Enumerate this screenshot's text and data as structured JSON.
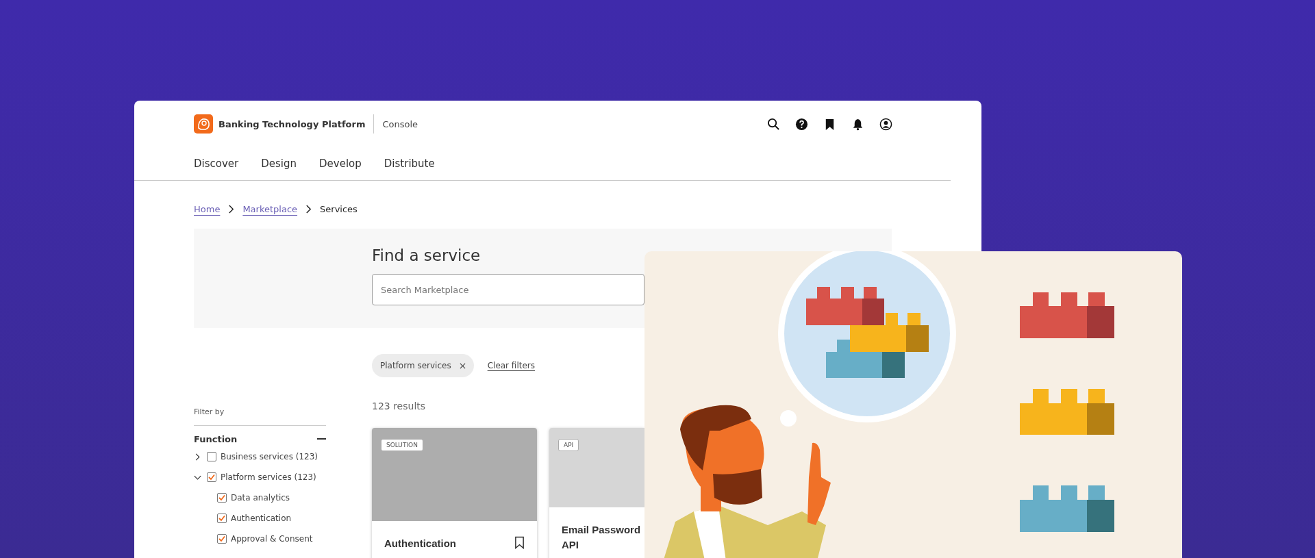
{
  "header": {
    "brand": "Banking Technology Platform",
    "section": "Console"
  },
  "nav": [
    {
      "label": "Discover"
    },
    {
      "label": "Design"
    },
    {
      "label": "Develop"
    },
    {
      "label": "Distribute"
    }
  ],
  "breadcrumb": [
    {
      "label": "Home",
      "link": true
    },
    {
      "label": "Marketplace",
      "link": true
    },
    {
      "label": "Services",
      "link": false
    }
  ],
  "hero": {
    "title": "Find a service",
    "search": {
      "placeholder": "Search Marketplace"
    }
  },
  "active_filters": {
    "chips": [
      "Platform services"
    ],
    "clear": "Clear filters"
  },
  "filters": {
    "heading": "Filter by",
    "group": {
      "title": "Function",
      "expanded": true,
      "items": [
        {
          "label": "Business services (123)",
          "checked": false,
          "expanded": false
        },
        {
          "label": "Platform services (123)",
          "checked": true,
          "expanded": true,
          "children": [
            {
              "label": "Data analytics",
              "checked": true
            },
            {
              "label": "Authentication",
              "checked": true
            },
            {
              "label": "Approval & Consent",
              "checked": true
            }
          ]
        }
      ]
    }
  },
  "results": {
    "count": "123 results",
    "cards": [
      {
        "tag": "SOLUTION",
        "title_lines": [
          "Authentication"
        ],
        "color": "#adadad",
        "bookmark": true
      },
      {
        "tag": "API",
        "title_lines": [
          "Email Password",
          "API"
        ],
        "color": "#d6d6d6"
      }
    ]
  }
}
